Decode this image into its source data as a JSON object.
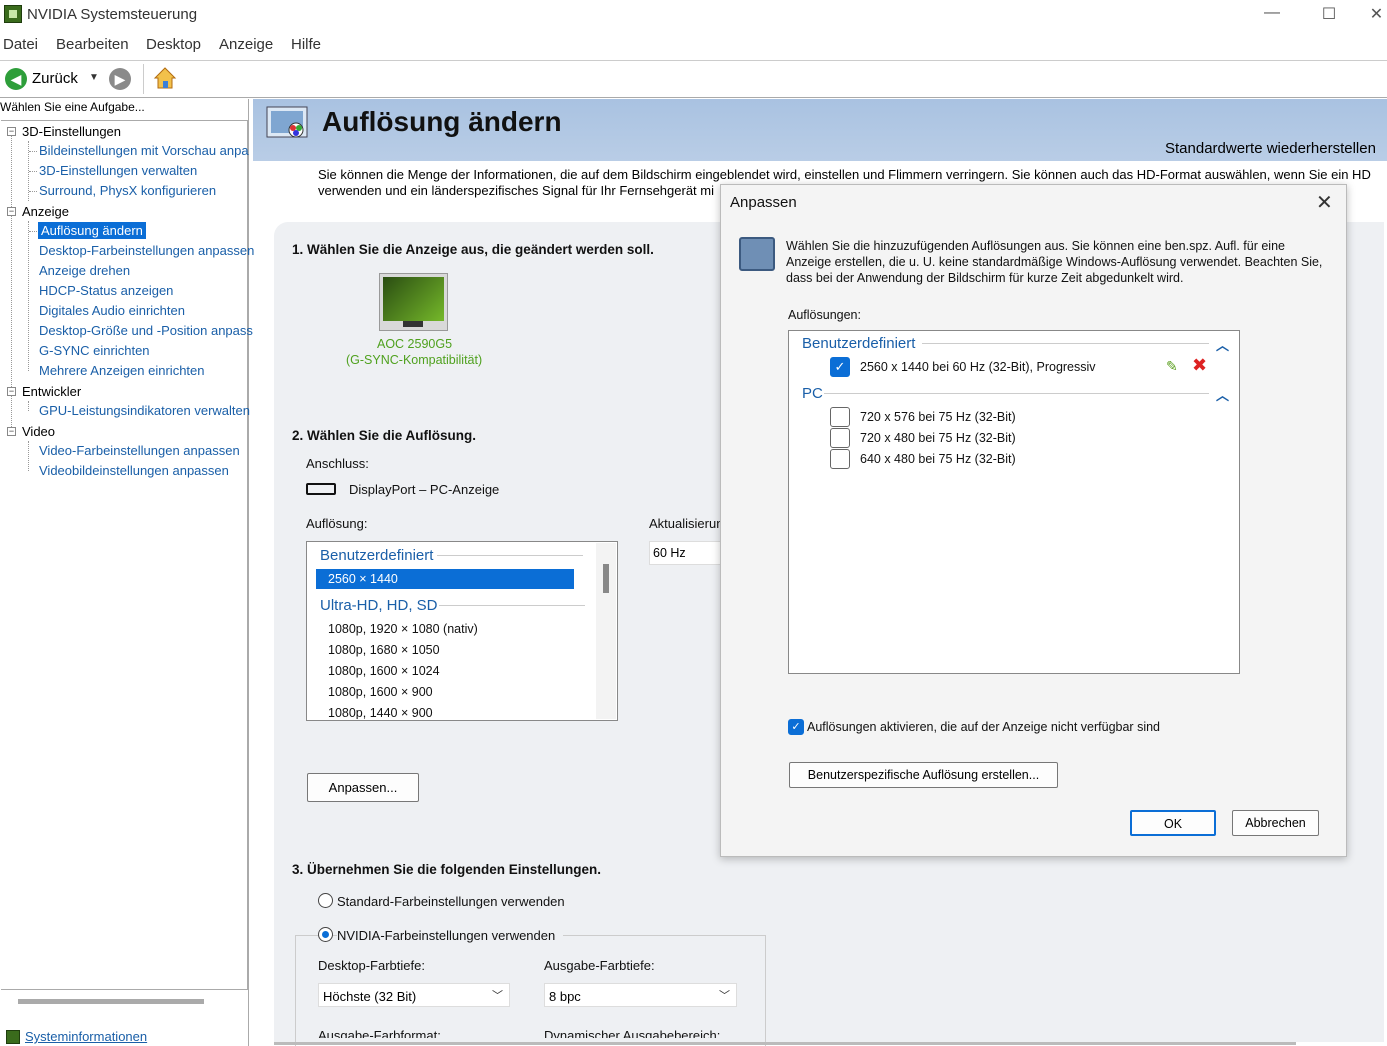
{
  "window": {
    "title": "NVIDIA Systemsteuerung",
    "minimize": "—",
    "maximize": "☐",
    "close": "✕"
  },
  "menu": [
    "Datei",
    "Bearbeiten",
    "Desktop",
    "Anzeige",
    "Hilfe"
  ],
  "toolbar": {
    "back_label": "Zurück",
    "dropdown": "▼"
  },
  "left": {
    "task_label": "Wählen Sie eine Aufgabe...",
    "tree": [
      {
        "label": "3D-Einstellungen",
        "children": [
          "Bildeinstellungen mit Vorschau anpa",
          "3D-Einstellungen verwalten",
          "Surround, PhysX konfigurieren"
        ]
      },
      {
        "label": "Anzeige",
        "children": [
          "Auflösung ändern",
          "Desktop-Farbeinstellungen anpassen",
          "Anzeige drehen",
          "HDCP-Status anzeigen",
          "Digitales Audio einrichten",
          "Desktop-Größe und -Position anpass",
          "G-SYNC einrichten",
          "Mehrere Anzeigen einrichten"
        ]
      },
      {
        "label": "Entwickler",
        "children": [
          "GPU-Leistungsindikatoren verwalten"
        ]
      },
      {
        "label": "Video",
        "children": [
          "Video-Farbeinstellungen anpassen",
          "Videobildeinstellungen anpassen"
        ]
      }
    ],
    "selected": "Auflösung ändern",
    "sysinfo": "Systeminformationen"
  },
  "main": {
    "title": "Auflösung ändern",
    "restore": "Standardwerte wiederherstellen",
    "intro_line1": "Sie können die Menge der Informationen, die auf dem Bildschirm eingeblendet wird, einstellen und Flimmern verringern. Sie können auch das HD-Format auswählen, wenn Sie ein HD",
    "intro_line2": "verwenden und ein länderspezifisches Signal für Ihr Fernsehgerät mi",
    "step1": "1. Wählen Sie die Anzeige aus, die geändert werden soll.",
    "monitor_name": "AOC 2590G5",
    "monitor_sub": "(G-SYNC-Kompatibilität)",
    "step2": "2. Wählen Sie die Auflösung.",
    "connection_label": "Anschluss:",
    "connection_value": "DisplayPort – PC-Anzeige",
    "resolution_label": "Auflösung:",
    "refresh_label": "Aktualisierun",
    "refresh_value": "60 Hz",
    "res_groups": [
      {
        "label": "Benutzerdefiniert",
        "items": [
          "2560 × 1440"
        ]
      },
      {
        "label": "Ultra-HD, HD, SD",
        "items": [
          "1080p, 1920 × 1080 (nativ)",
          "1080p, 1680 × 1050",
          "1080p, 1600 × 1024",
          "1080p, 1600 × 900",
          "1080p, 1440 × 900"
        ]
      }
    ],
    "customize_button": "Anpassen...",
    "step3": "3. Übernehmen Sie die folgenden Einstellungen.",
    "radio_standard": "Standard-Farbeinstellungen verwenden",
    "radio_nvidia": "NVIDIA-Farbeinstellungen verwenden",
    "desktop_depth_label": "Desktop-Farbtiefe:",
    "desktop_depth_value": "Höchste (32 Bit)",
    "output_depth_label": "Ausgabe-Farbtiefe:",
    "output_depth_value": "8 bpc",
    "output_format_label": "Ausgabe-Farbformat:",
    "dynamic_range_label": "Dynamischer Ausgabebereich:"
  },
  "dialog": {
    "title": "Anpassen",
    "description": "Wählen Sie die hinzuzufügenden Auflösungen aus. Sie können eine ben.spz. Aufl. für eine Anzeige erstellen, die u. U. keine standardmäßige Windows-Auflösung verwendet. Beachten Sie, dass bei der Anwendung der Bildschirm für kurze Zeit abgedunkelt wird.",
    "list_label": "Auflösungen:",
    "group_custom": "Benutzerdefiniert",
    "custom_item": "2560 x 1440 bei 60 Hz (32-Bit), Progressiv",
    "group_pc": "PC",
    "pc_items": [
      "720 x 576 bei 75 Hz (32-Bit)",
      "720 x 480 bei 75 Hz (32-Bit)",
      "640 x 480 bei 75 Hz (32-Bit)"
    ],
    "enable_unavailable": "Auflösungen aktivieren, die auf der Anzeige nicht verfügbar sind",
    "create_custom": "Benutzerspezifische Auflösung erstellen...",
    "ok": "OK",
    "cancel": "Abbrechen"
  },
  "colors": {
    "accent": "#0b6ed6",
    "link": "#1a5fa8",
    "nvidia_green": "#76b900",
    "banner": "#b0c7e3"
  }
}
